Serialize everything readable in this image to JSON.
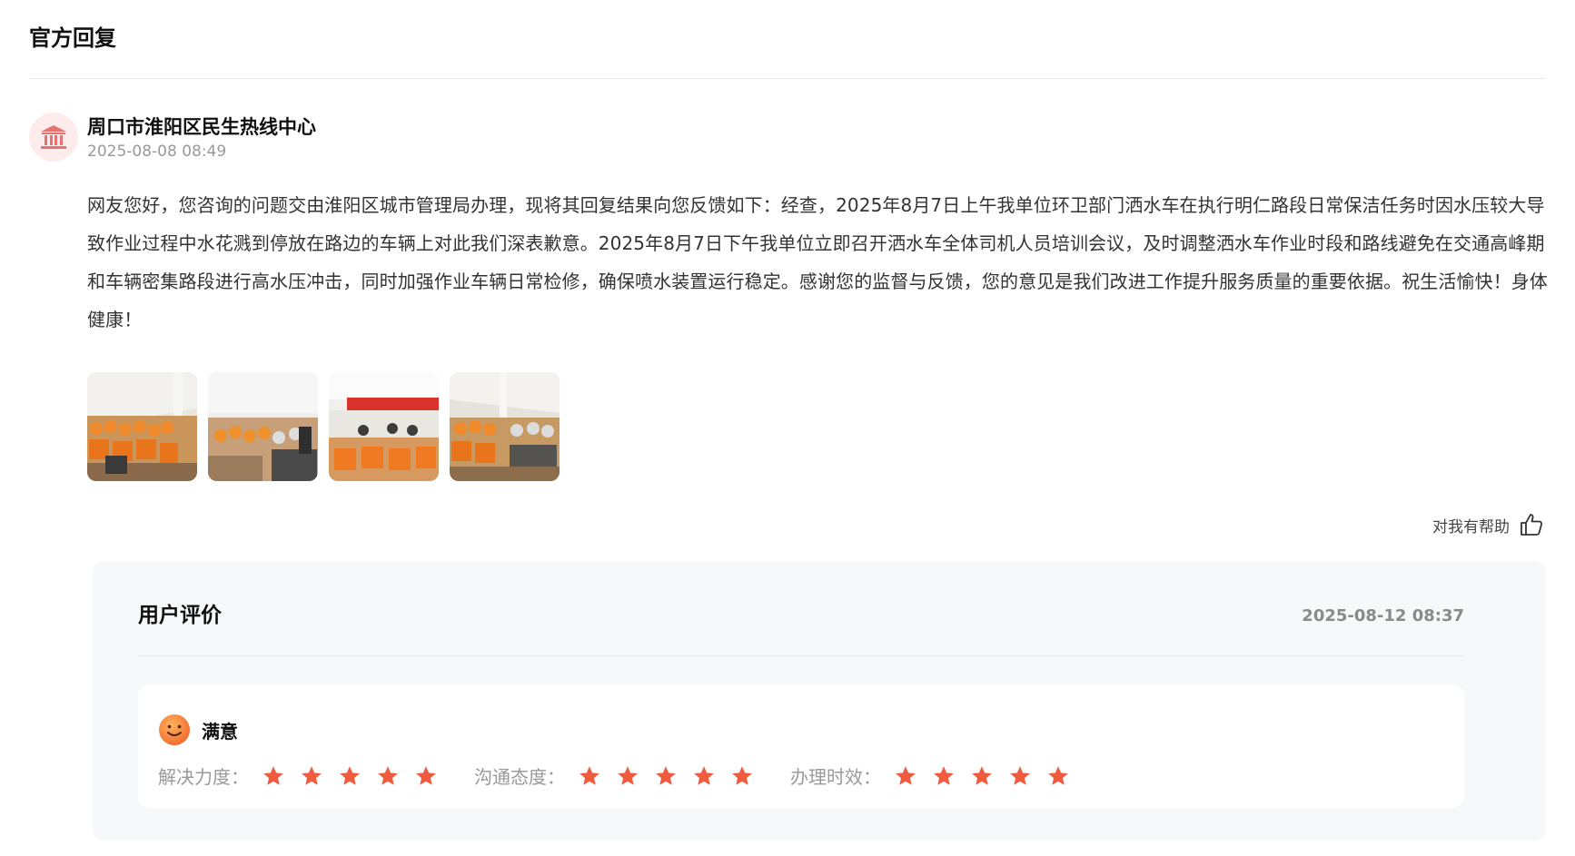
{
  "section": {
    "title": "官方回复"
  },
  "reply": {
    "org_name": "周口市淮阳区民生热线中心",
    "time": "2025-08-08 08:49",
    "avatar_icon": "government-building-icon",
    "body": "网友您好，您咨询的问题交由淮阳区城市管理局办理，现将其回复结果向您反馈如下：经查，2025年8月7日上午我单位环卫部门洒水车在执行明仁路段日常保洁任务时因水压较大导致作业过程中水花溅到停放在路边的车辆上对此我们深表歉意。2025年8月7日下午我单位立即召开洒水车全体司机人员培训会议，及时调整洒水车作业时段和路线避免在交通高峰期和车辆密集路段进行高水压冲击，同时加强作业车辆日常检修，确保喷水装置运行稳定。感谢您的监督与反馈，您的意见是我们改进工作提升服务质量的重要依据。祝生活愉快！身体健康！",
    "photo_count": 4,
    "helpful_label": "对我有帮助",
    "helpful_icon": "thumbs-up-icon"
  },
  "review": {
    "title": "用户评价",
    "time": "2025-08-12 08:37",
    "satisfaction_icon": "smiley-face-icon",
    "satisfaction": "满意",
    "ratings": [
      {
        "label": "解决力度：",
        "stars": 5,
        "max": 5
      },
      {
        "label": "沟通态度：",
        "stars": 5,
        "max": 5
      },
      {
        "label": "办理时效：",
        "stars": 5,
        "max": 5
      }
    ]
  },
  "colors": {
    "star": "#ef5b3f",
    "avatar_bg": "#fdeceb",
    "avatar_icon": "#e57373",
    "panel_bg": "#f7f8fa",
    "smiley": "#f6843a"
  }
}
